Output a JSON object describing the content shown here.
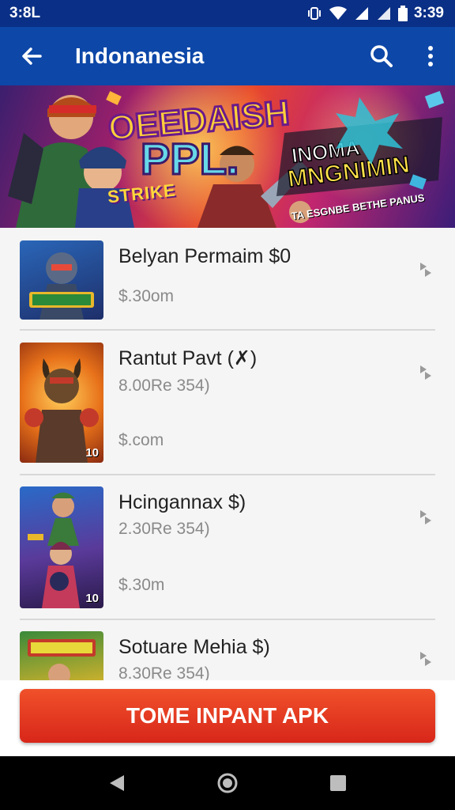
{
  "status_bar": {
    "time": "3:8L",
    "clock": "3:39"
  },
  "app_bar": {
    "title": "Indonanesia",
    "icons": [
      "back-arrow-icon",
      "search-icon",
      "more-vert-icon"
    ]
  },
  "banner": {
    "text_left": "OEEDAISH PPL.",
    "text_left_sub": "STRIKE",
    "text_right": "INOMA MNGNIMIN",
    "text_right_sub": "TA ESGNBE BETHE PANUS"
  },
  "items": [
    {
      "title": "Belyan Permaim $0",
      "subtitle": "",
      "price": "$.30om",
      "badge": ""
    },
    {
      "title": "Rantut Pavt (✗)",
      "subtitle": "8.00Re 354)",
      "price": "$.com",
      "badge": "10"
    },
    {
      "title": "Hcingannax $)",
      "subtitle": "2.30Re 354)",
      "price": "$.30m",
      "badge": "10"
    },
    {
      "title": "Sotuare Mehia $)",
      "subtitle": "8.30Re 354)",
      "price": "",
      "badge": ""
    }
  ],
  "cta": {
    "label": "TOME INPANT APK"
  },
  "colors": {
    "status_bar": "#0a2f86",
    "app_bar": "#0d47a8",
    "cta": "#e23a20"
  }
}
